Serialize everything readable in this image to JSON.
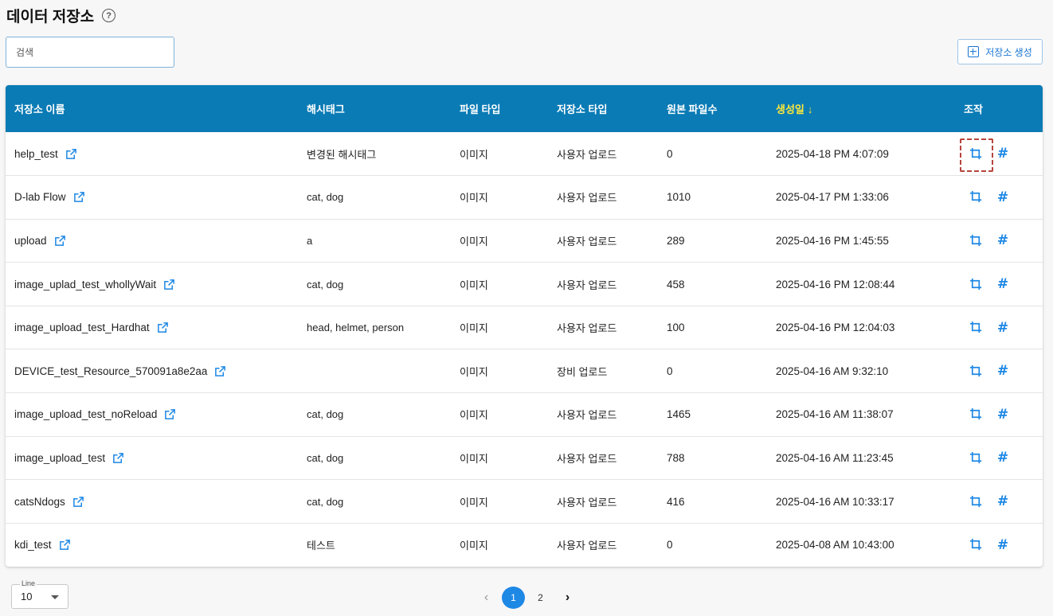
{
  "header": {
    "title": "데이터 저장소",
    "help_icon": "question-circle-icon"
  },
  "search": {
    "placeholder": "검색",
    "value": ""
  },
  "toolbar": {
    "create_label": "저장소 생성",
    "create_icon": "plus-square-icon"
  },
  "table": {
    "columns": [
      "저장소 이름",
      "해시태그",
      "파일 타입",
      "저장소 타입",
      "원본 파일수",
      "생성일",
      "조작"
    ],
    "sort_column": "생성일",
    "sort_arrow": "↓",
    "rows": [
      {
        "name": "help_test",
        "tags": "변경된 해시태그",
        "file_type": "이미지",
        "repo_type": "사용자 업로드",
        "count": "0",
        "created": "2025-04-18 PM 4:07:09"
      },
      {
        "name": "D-lab Flow",
        "tags": "cat, dog",
        "file_type": "이미지",
        "repo_type": "사용자 업로드",
        "count": "1010",
        "created": "2025-04-17 PM 1:33:06"
      },
      {
        "name": "upload",
        "tags": "a",
        "file_type": "이미지",
        "repo_type": "사용자 업로드",
        "count": "289",
        "created": "2025-04-16 PM 1:45:55"
      },
      {
        "name": "image_uplad_test_whollyWait",
        "tags": "cat, dog",
        "file_type": "이미지",
        "repo_type": "사용자 업로드",
        "count": "458",
        "created": "2025-04-16 PM 12:08:44"
      },
      {
        "name": "image_upload_test_Hardhat",
        "tags": "head, helmet, person",
        "file_type": "이미지",
        "repo_type": "사용자 업로드",
        "count": "100",
        "created": "2025-04-16 PM 12:04:03"
      },
      {
        "name": "DEVICE_test_Resource_570091a8e2aa",
        "tags": "",
        "file_type": "이미지",
        "repo_type": "장비 업로드",
        "count": "0",
        "created": "2025-04-16 AM 9:32:10"
      },
      {
        "name": "image_upload_test_noReload",
        "tags": "cat, dog",
        "file_type": "이미지",
        "repo_type": "사용자 업로드",
        "count": "1465",
        "created": "2025-04-16 AM 11:38:07"
      },
      {
        "name": "image_upload_test",
        "tags": "cat, dog",
        "file_type": "이미지",
        "repo_type": "사용자 업로드",
        "count": "788",
        "created": "2025-04-16 AM 11:23:45"
      },
      {
        "name": "catsNdogs",
        "tags": "cat, dog",
        "file_type": "이미지",
        "repo_type": "사용자 업로드",
        "count": "416",
        "created": "2025-04-16 AM 10:33:17"
      },
      {
        "name": "kdi_test",
        "tags": "테스트",
        "file_type": "이미지",
        "repo_type": "사용자 업로드",
        "count": "0",
        "created": "2025-04-08 AM 10:43:00"
      }
    ],
    "op_icons": [
      "crop-icon",
      "hashtag-icon"
    ],
    "hash_glyph": "#"
  },
  "pagination": {
    "line_label": "Line",
    "line_value": "10",
    "prev": "‹",
    "pages": [
      "1",
      "2"
    ],
    "active_page": "1",
    "next": "›"
  },
  "colors": {
    "header_bg": "#0a7bb5",
    "accent": "#1e88e5",
    "sort_highlight": "#ffe93b",
    "annotation": "#b5453d"
  }
}
